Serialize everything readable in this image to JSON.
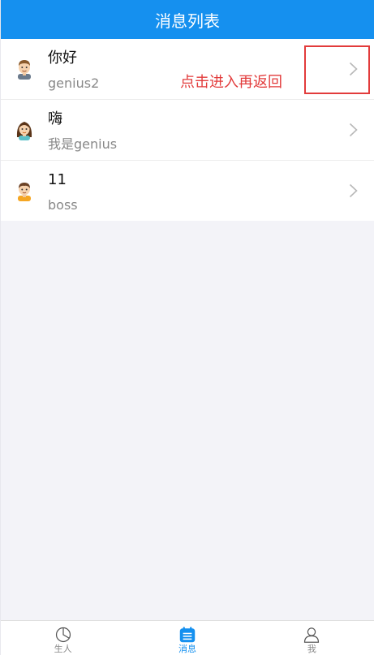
{
  "header": {
    "title": "消息列表"
  },
  "messages": [
    {
      "title": "你好",
      "subtitle": "genius2",
      "avatar": "avatar-man-icon"
    },
    {
      "title": "嗨",
      "subtitle": "我是genius",
      "avatar": "avatar-woman-icon"
    },
    {
      "title": "11",
      "subtitle": "boss",
      "avatar": "avatar-boy-icon"
    }
  ],
  "annotation": {
    "text": "点击进入再返回"
  },
  "tabbar": {
    "tabs": [
      {
        "label": "生人",
        "icon": "pie-chart-icon",
        "active": false
      },
      {
        "label": "消息",
        "icon": "message-list-icon",
        "active": true
      },
      {
        "label": "我",
        "icon": "person-icon",
        "active": false
      }
    ]
  },
  "colors": {
    "header_bg": "#1590ef",
    "active_tab": "#1590ef",
    "annotation_red": "#e23b3b",
    "page_bg": "#f3f3f8"
  }
}
